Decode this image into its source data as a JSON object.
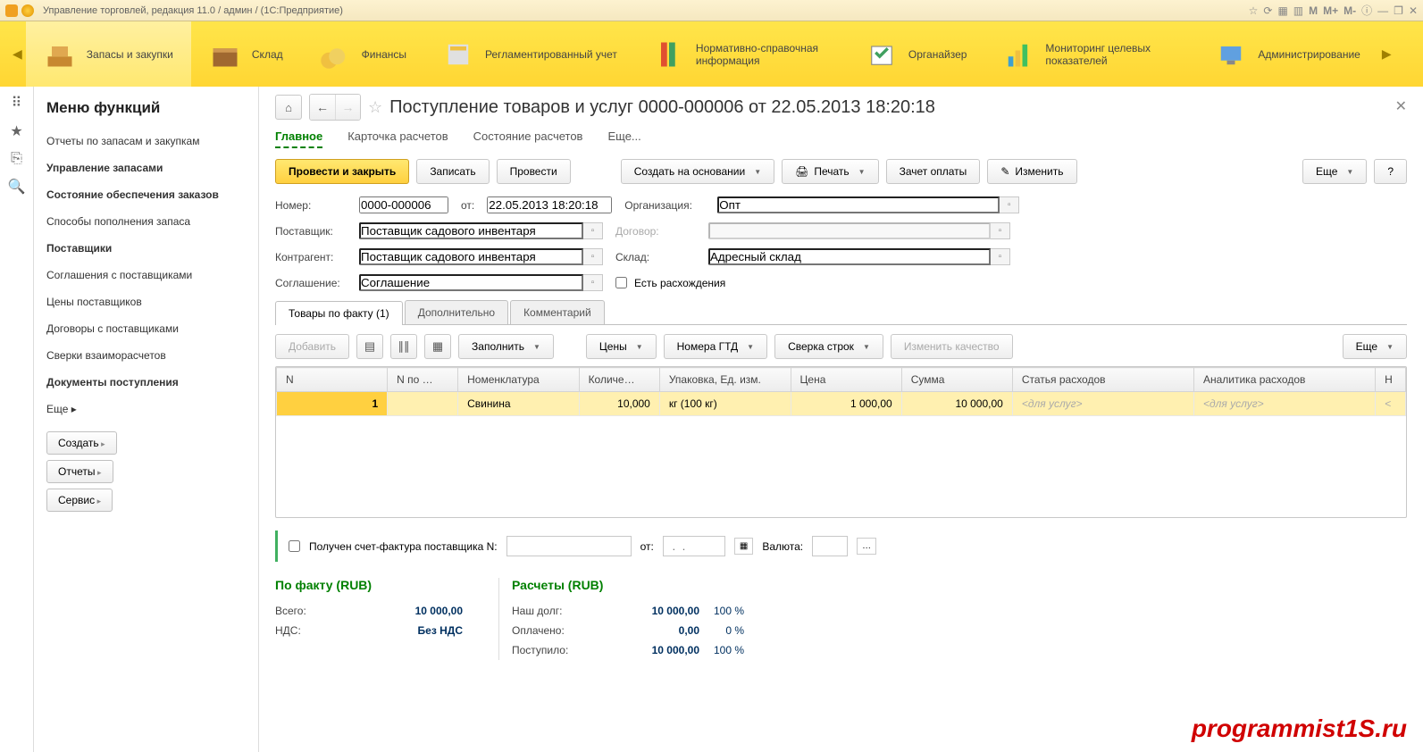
{
  "titlebar": {
    "text": "Управление торговлей, редакция 11.0 / админ /   (1С:Предприятие)",
    "m_buttons": [
      "M",
      "M+",
      "M-"
    ]
  },
  "top_nav": {
    "items": [
      {
        "label": "Запасы и закупки"
      },
      {
        "label": "Склад"
      },
      {
        "label": "Финансы"
      },
      {
        "label": "Регламентированный учет"
      },
      {
        "label": "Нормативно-справочная информация"
      },
      {
        "label": "Органайзер"
      },
      {
        "label": "Мониторинг целевых показателей"
      },
      {
        "label": "Администрирование"
      }
    ]
  },
  "sidebar": {
    "title": "Меню функций",
    "items": [
      {
        "label": "Отчеты по запасам и закупкам",
        "bold": false
      },
      {
        "label": "Управление запасами",
        "bold": true
      },
      {
        "label": "Состояние обеспечения заказов",
        "bold": true
      },
      {
        "label": "Способы пополнения запаса",
        "bold": false
      },
      {
        "label": "Поставщики",
        "bold": true
      },
      {
        "label": "Соглашения с поставщиками",
        "bold": false
      },
      {
        "label": "Цены поставщиков",
        "bold": false
      },
      {
        "label": "Договоры с поставщиками",
        "bold": false
      },
      {
        "label": "Сверки взаиморасчетов",
        "bold": false
      },
      {
        "label": "Документы поступления",
        "bold": true
      },
      {
        "label": "Еще ▸",
        "bold": false
      }
    ],
    "buttons": {
      "create": "Создать",
      "reports": "Отчеты",
      "service": "Сервис"
    }
  },
  "document": {
    "title": "Поступление товаров и услуг 0000-000006 от 22.05.2013 18:20:18",
    "tabs": {
      "main": "Главное",
      "card": "Карточка расчетов",
      "state": "Состояние расчетов",
      "more": "Еще..."
    },
    "toolbar": {
      "post_close": "Провести и закрыть",
      "save": "Записать",
      "post": "Провести",
      "create_based": "Создать на основании",
      "print": "Печать",
      "offset": "Зачет оплаты",
      "edit": "Изменить",
      "more": "Еще",
      "help": "?"
    },
    "form": {
      "number_label": "Номер:",
      "number": "0000-000006",
      "from_label": "от:",
      "from": "22.05.2013 18:20:18",
      "org_label": "Организация:",
      "org": "Опт",
      "supplier_label": "Поставщик:",
      "supplier": "Поставщик садового инвентаря",
      "contract_label": "Договор:",
      "contract": "",
      "counterparty_label": "Контрагент:",
      "counterparty": "Поставщик садового инвентаря",
      "warehouse_label": "Склад:",
      "warehouse": "Адресный склад",
      "agreement_label": "Соглашение:",
      "agreement": "Соглашение",
      "diff_label": "Есть расхождения"
    },
    "sub_tabs": {
      "fact": "Товары по факту (1)",
      "extra": "Дополнительно",
      "comment": "Комментарий"
    },
    "table_toolbar": {
      "add": "Добавить",
      "fill": "Заполнить",
      "prices": "Цены",
      "gtd": "Номера ГТД",
      "reconcile": "Сверка строк",
      "quality": "Изменить качество",
      "more": "Еще"
    },
    "table": {
      "headers": {
        "n": "N",
        "n_by": "N по …",
        "item": "Номенклатура",
        "qty": "Количе…",
        "pack": "Упаковка, Ед. изм.",
        "price": "Цена",
        "sum": "Сумма",
        "exp": "Статья расходов",
        "ana": "Аналитика расходов",
        "h": "Н"
      },
      "row": {
        "n": "1",
        "n_by": "",
        "item": "Свинина",
        "qty": "10,000",
        "pack": "кг (100 кг)",
        "price": "1 000,00",
        "sum": "10 000,00",
        "exp": "<для услуг>",
        "ana": "<для услуг>",
        "h": "<"
      }
    },
    "invoice": {
      "chk_label": "Получен счет-фактура поставщика N:",
      "from_label": "от:",
      "currency_label": "Валюта:"
    },
    "totals": {
      "fact_title": "По факту (RUB)",
      "calc_title": "Расчеты (RUB)",
      "total_label": "Всего:",
      "total": "10 000,00",
      "vat_label": "НДС:",
      "vat": "Без НДС",
      "debt_label": "Наш долг:",
      "debt": "10 000,00",
      "debt_pct": "100 %",
      "paid_label": "Оплачено:",
      "paid": "0,00",
      "paid_pct": "0 %",
      "received_label": "Поступило:",
      "received": "10 000,00",
      "received_pct": "100 %"
    }
  },
  "watermark": "programmist1S.ru"
}
